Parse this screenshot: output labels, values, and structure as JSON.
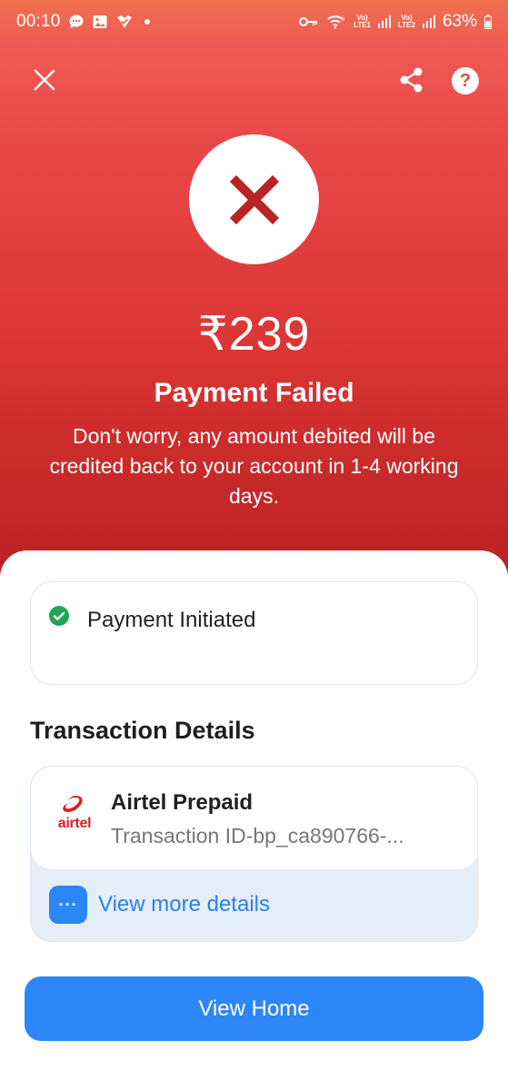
{
  "status_bar": {
    "time": "00:10",
    "battery": "63%",
    "net1": "Vo)\nLTE1",
    "net2": "Vo)\nLTE2",
    "icons": [
      "chat-icon",
      "gallery-icon",
      "app-icon",
      "key-icon",
      "wifi-icon",
      "signal-icon",
      "battery-icon"
    ]
  },
  "header": {
    "close_icon": "close-icon",
    "share_icon": "share-icon",
    "help_label": "?"
  },
  "payment": {
    "amount": "₹239",
    "status": "Payment Failed",
    "message": "Don't worry, any amount debited will be credited back to your account in 1-4 working days."
  },
  "progress": {
    "step_label": "Payment Initiated"
  },
  "transaction": {
    "section_title": "Transaction Details",
    "logo_text": "airtel",
    "merchant": "Airtel Prepaid",
    "id_text": "Transaction ID-bp_ca890766-...",
    "more_icon_text": "···",
    "more_label": "View more details"
  },
  "actions": {
    "home_label": "View Home"
  },
  "colors": {
    "header_red": "#e23f3f",
    "primary_blue": "#2d86f8",
    "success_green": "#22a556",
    "fail_mark": "#b82323"
  }
}
